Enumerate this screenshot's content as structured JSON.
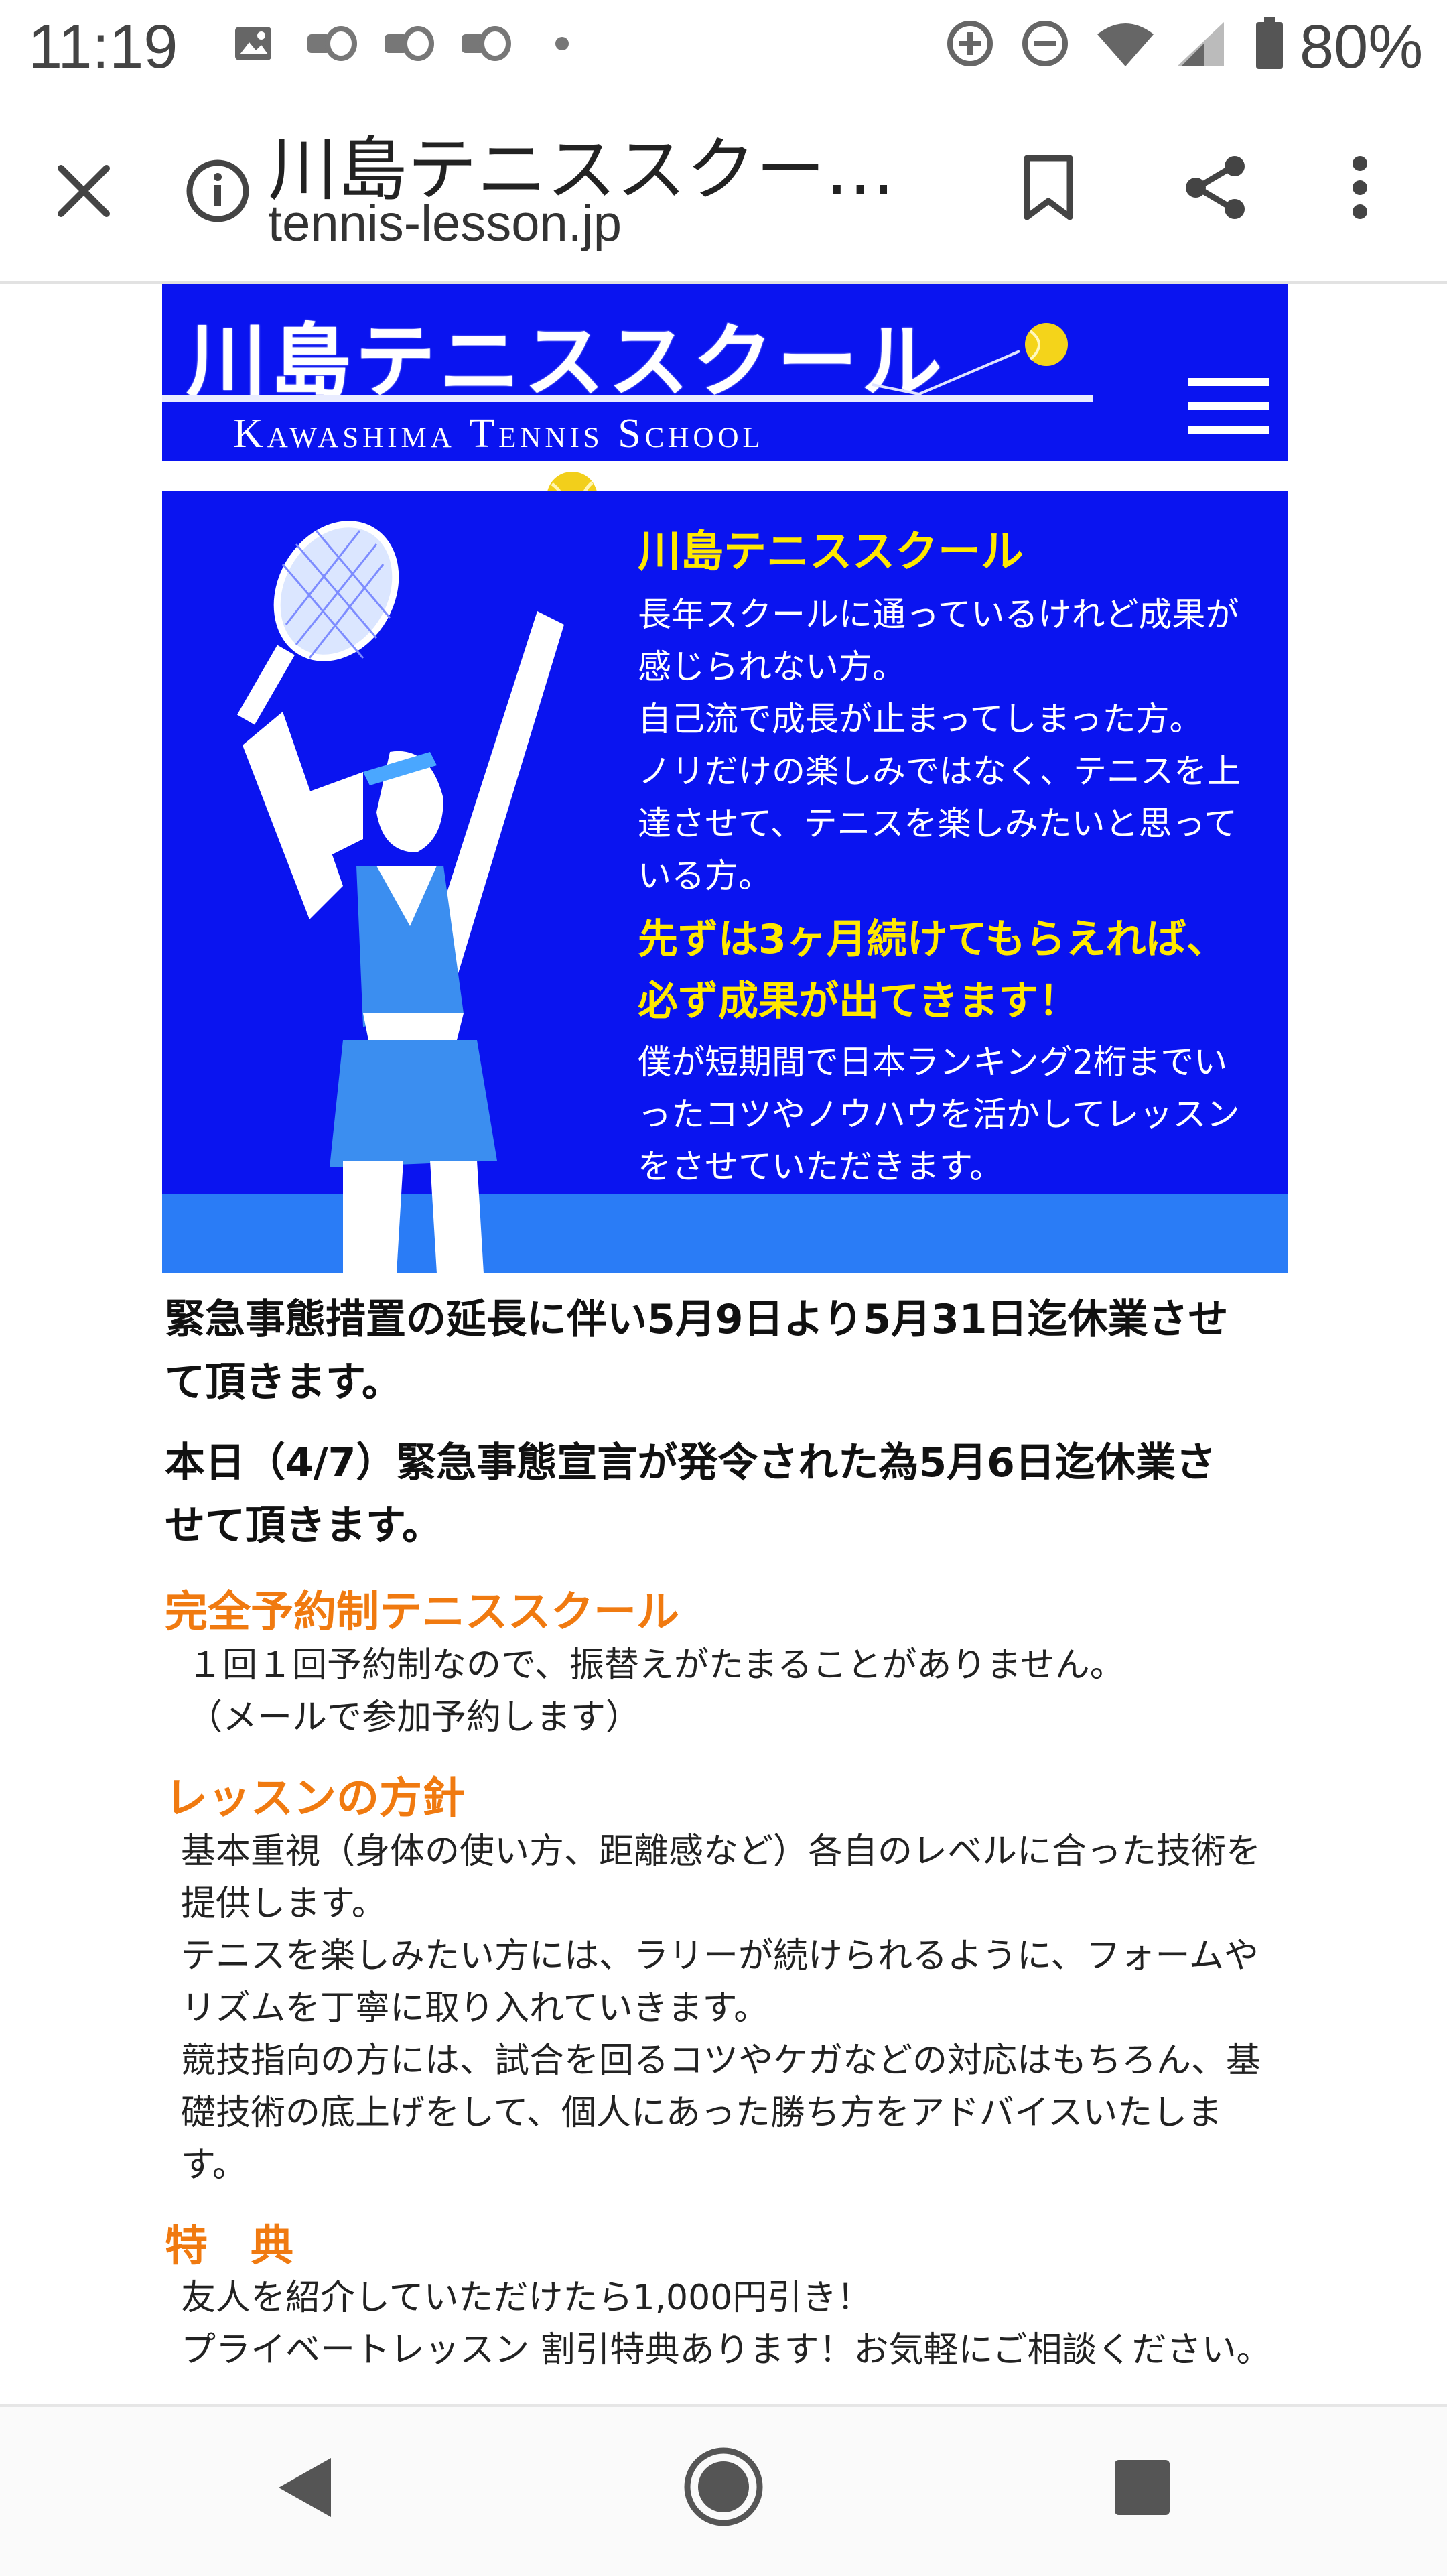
{
  "status_bar": {
    "time": "11:19",
    "battery_text": "80%",
    "icons": [
      "gallery-icon",
      "speaker-icon",
      "speaker-icon",
      "speaker-icon",
      "dot-icon",
      "sync-icon",
      "dnd-icon",
      "wifi-icon",
      "signal-icon",
      "battery-icon"
    ]
  },
  "browser": {
    "title": "川島テニススクー…",
    "url": "tennis-lesson.jp"
  },
  "site": {
    "logo_jp": "川島テニススクール",
    "logo_en": "Kawashima Tennis School"
  },
  "hero": {
    "title": "川島テニススクール",
    "lines1": [
      "長年スクールに通っているけれど成果が",
      "感じられない方。",
      "自己流で成長が止まってしまった方。",
      "ノリだけの楽しみではなく、テニスを上",
      "達させて、テニスを楽しみたいと思って",
      "いる方。"
    ],
    "emphasis1": "先ずは3ヶ月続けてもらえれば、",
    "emphasis2": "必ず成果が出てきます！",
    "lines2": [
      "僕が短期間で日本ランキング2桁までい",
      "ったコツやノウハウを活かしてレッスン",
      "をさせていただきます。"
    ]
  },
  "notices": [
    "緊急事態措置の延長に伴い5月9日より5月31日迄休業させ",
    "て頂きます。",
    "本日（4/7）緊急事態宣言が発令された為5月6日迄休業さ",
    "せて頂きます。"
  ],
  "sections": {
    "reservation": {
      "title": "完全予約制テニススクール",
      "lines": [
        "１回１回予約制なので、振替えがたまることがありません。",
        "（メールで参加予約します）"
      ]
    },
    "policy": {
      "title": "レッスンの方針",
      "lines": [
        "基本重視（身体の使い方、距離感など）各自のレベルに合った技術を",
        "提供します。",
        "テニスを楽しみたい方には、ラリーが続けられるように、フォームや",
        "リズムを丁寧に取り入れていきます。",
        "競技指向の方には、試合を回るコツやケガなどの対応はもちろん、基",
        "礎技術の底上げをして、個人にあった勝ち方をアドバイスいたしま",
        "す。"
      ]
    },
    "benefits": {
      "title": "特　典",
      "lines": [
        "友人を紹介していただけたら1,000円引き！",
        "プライベートレッスン 割引特典あります！お気軽にご相談ください。"
      ]
    }
  },
  "colors": {
    "brand_blue": "#0a14f0",
    "accent_yellow": "#ffe800",
    "section_orange": "#f07a10"
  }
}
